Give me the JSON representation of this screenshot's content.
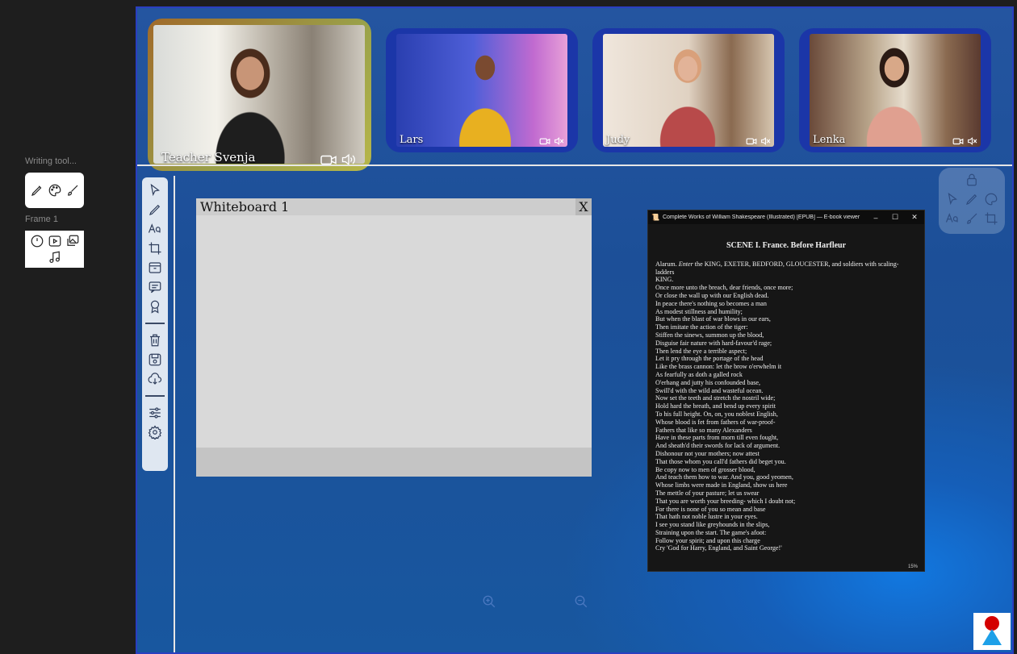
{
  "left_panel": {
    "writing_tools_label": "Writing tool...",
    "frame_label": "Frame 1",
    "writing_tools_icons": [
      "pencil-icon",
      "palette-icon",
      "brush-icon"
    ],
    "frame_icons": [
      "clock-icon",
      "play-icon",
      "gallery-icon",
      "music-icon"
    ]
  },
  "participants": [
    {
      "name": "Teacher Svenja",
      "role": "teacher",
      "active": true
    },
    {
      "name": "Lars",
      "role": "student"
    },
    {
      "name": "Judy",
      "role": "student"
    },
    {
      "name": "Lenka",
      "role": "student"
    }
  ],
  "toolbar": {
    "tools": [
      "select-icon",
      "pen-icon",
      "text-icon",
      "crop-icon",
      "archive-icon",
      "comment-icon",
      "badge-icon"
    ],
    "file_actions": [
      "trash-icon",
      "save-icon",
      "cloud-download-icon"
    ],
    "settings": [
      "sliders-icon",
      "gear-icon"
    ]
  },
  "whiteboard": {
    "title": "Whiteboard 1",
    "close_label": "X"
  },
  "ebook": {
    "window_title": "Complete Works of William Shakespeare (Illustrated) [EPUB] — E-book viewer",
    "minimize": "–",
    "maximize": "☐",
    "close": "✕",
    "scene_heading": "SCENE I. France. Before Harfleur",
    "stage_prefix": "Alarum. ",
    "stage_enter": "Enter",
    "stage_rest": " the KING, EXETER, BEDFORD, GLOUCESTER, and soldiers with scaling-ladders",
    "lines": [
      "KING.",
      "Once more unto the breach, dear friends, once more;",
      "Or close the wall up with our English dead.",
      "In peace there's nothing so becomes a man",
      "As modest stillness and humility;",
      "But when the blast of war blows in our ears,",
      "Then imitate the action of the tiger:",
      "Stiffen the sinews, summon up the blood,",
      "Disguise fair nature with hard-favour'd rage;",
      "Then lend the eye a terrible aspect;",
      "Let it pry through the portage of the head",
      "Like the brass cannon: let the brow o'erwhelm it",
      "As fearfully as doth a galled rock",
      "O'erhang and jutty his confounded base,",
      "Swill'd with the wild and wasteful ocean.",
      "Now set the teeth and stretch the nostril wide;",
      "Hold hard the breath, and bend up every spirit",
      "To his full height. On, on, you noblest English,",
      "Whose blood is fet from fathers of war-proof-",
      "Fathers that like so many Alexanders",
      "Have in these parts from morn till even fought,",
      "And sheath'd their swords for lack of argument.",
      "Dishonour not your mothers; now attest",
      "That those whom you call'd fathers did beget you.",
      "Be copy now to men of grosser blood,",
      "And teach them how to war. And you, good yeomen,",
      "Whose limbs were made in England, show us here",
      "The mettle of your pasture; let us swear",
      "That you are worth your breeding- which I doubt not;",
      "For there is none of you so mean and base",
      "That hath not noble lustre in your eyes.",
      "I see you stand like greyhounds in the slips,",
      "Straining upon the start. The game's afoot:",
      "Follow your spirit; and upon this charge",
      "Cry 'God for Harry, England, and Saint George!'"
    ],
    "progress": "15%"
  },
  "right_panel": {
    "icons": [
      "lock-icon",
      "pointer-icon",
      "pen-icon",
      "palette-icon",
      "text-icon",
      "brush-icon",
      "crop-icon"
    ]
  },
  "colors": {
    "stage": "#1c4f98",
    "border": "#2a3fc0",
    "teacher_frame": "#b79a3a",
    "student_frame": "#1b36a8",
    "toolbar": "#dfe7f1"
  }
}
